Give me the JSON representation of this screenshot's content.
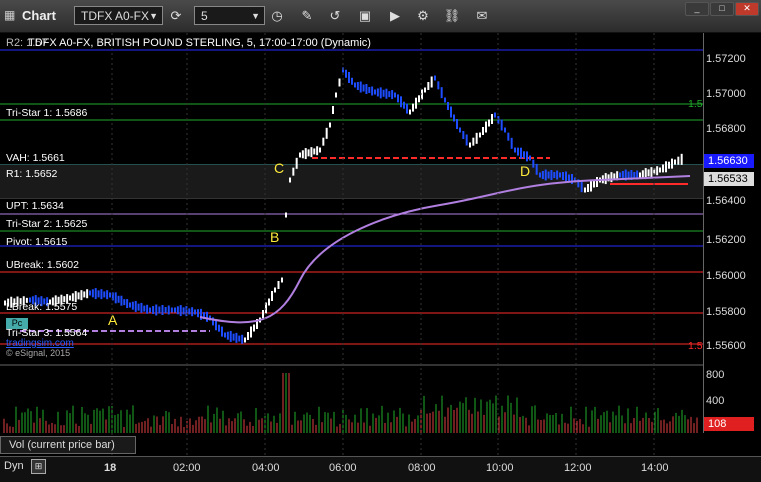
{
  "window": {
    "title": "Chart"
  },
  "toolbar": {
    "symbol": "TDFX A0-FX",
    "interval": "5"
  },
  "chart": {
    "header": "TDFX A0-FX, BRITISH POUND STERLING, 5, 17:00-17:00 (Dynamic)",
    "header_prefix": "R2: 1.57",
    "copyright": "© eSignal, 2015",
    "link_text": "tradingsim.com",
    "level_labels": [
      "Tri-Star 1: 1.5686",
      "VAH: 1.5661",
      "R1: 1.5652",
      "UPT: 1.5634",
      "Tri-Star 2: 1.5625",
      "Pivot: 1.5615",
      "UBreak: 1.5602",
      "LBreak: 1.5575",
      "Tri-Star 3: 1.5564"
    ],
    "markers": [
      "A",
      "B",
      "C",
      "D"
    ],
    "price_labels": [
      "1.57200",
      "1.57000",
      "1.56800",
      "1.56400",
      "1.56200",
      "1.56000",
      "1.55800",
      "1.55600"
    ],
    "current_price": "1.56630",
    "second_price": "1.56533",
    "right_edge_labels": [
      "1.5",
      "1.5"
    ],
    "pc_badge": "Pc"
  },
  "volume": {
    "label": "Vol (current price bar)",
    "scale": [
      "800",
      "400",
      "0"
    ],
    "current_volume": "108"
  },
  "time_axis": {
    "mode": "Dyn",
    "labels": [
      "18",
      "02:00",
      "04:00",
      "06:00",
      "08:00",
      "10:00",
      "12:00",
      "14:00"
    ]
  },
  "colors": {
    "background": "#000000",
    "up_bar": "#ffffff",
    "down_bar": "#1e4dff",
    "moving_average": "#b07fe0",
    "resistance": "#ff2a2a",
    "level_green": "#1faa2a",
    "level_blue": "#2a2aff",
    "price_highlight": "#1a1aff",
    "volume_up": "#1fae2b",
    "volume_down": "#e04040",
    "volume_badge": "#e02020"
  },
  "icons": [
    "chart-icon",
    "refresh-icon",
    "clock-icon",
    "pencil-icon",
    "magnet-icon",
    "chart-settings-icon",
    "play-icon",
    "gear-icon",
    "link-icon",
    "comment-icon",
    "minimize-icon",
    "maximize-icon",
    "close-icon"
  ]
}
